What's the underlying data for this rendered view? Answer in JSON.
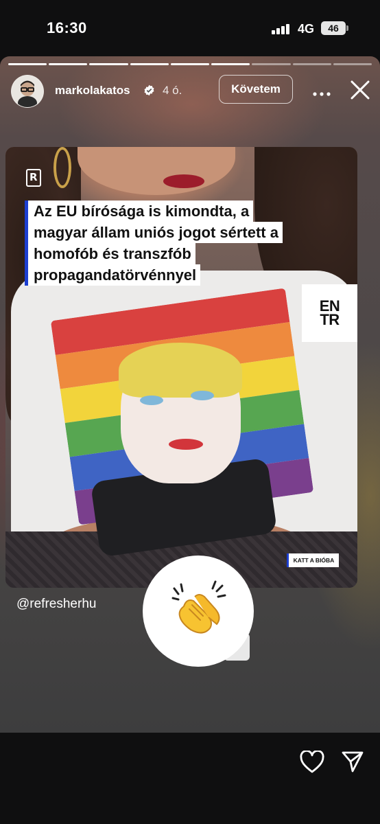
{
  "status_bar": {
    "time": "16:30",
    "network": "4G",
    "battery": "46"
  },
  "story": {
    "progress_segments_total": 9,
    "progress_segments_done": 6,
    "username": "markolakatos",
    "verified_icon": "verified-badge-icon",
    "time_ago": "4 ó.",
    "follow_label": "Követem",
    "more_icon": "more-icon",
    "close_icon": "close-icon"
  },
  "post": {
    "brand_logo": "R",
    "headline_lines": [
      "Az EU bírósága is kimondta, a",
      "magyar állam uniós jogot sértett a",
      "homofób és transzfób",
      "propagandatörvénnyel"
    ],
    "badge_line1": "EN",
    "badge_line2": "TR",
    "bio_badge": "KATT A BIÓBA"
  },
  "mention": "@refresherhu",
  "reaction_sticker": "clapping-hands-icon",
  "bottom_bar": {
    "like_icon": "heart-icon",
    "share_icon": "send-icon"
  },
  "colors": {
    "accent_blue": "#1c3fd1",
    "background": "#0f0f10"
  }
}
